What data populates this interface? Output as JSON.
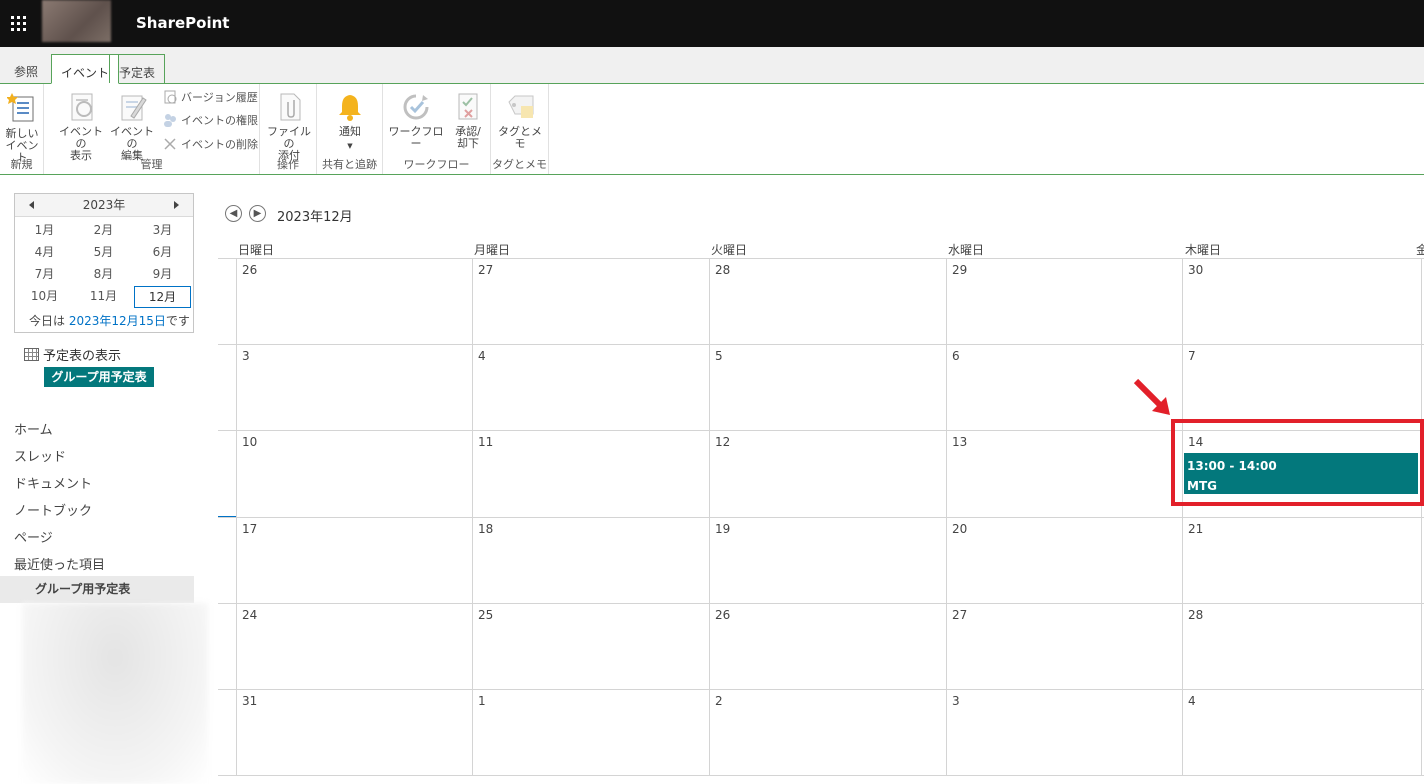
{
  "suitebar": {
    "brand": "SharePoint"
  },
  "tabs": [
    "参照",
    "イベント",
    "予定表"
  ],
  "ribbon": {
    "new_event_l1": "新しい",
    "new_event_l2": "イベント",
    "group_new": "新規",
    "view_event_l1": "イベントの",
    "view_event_l2": "表示",
    "edit_event_l1": "イベントの",
    "edit_event_l2": "編集",
    "version_history": "バージョン履歴",
    "event_permissions": "イベントの権限",
    "delete_event": "イベントの削除",
    "group_manage": "管理",
    "attach_l1": "ファイルの",
    "attach_l2": "添付",
    "group_actions": "操作",
    "notify": "通知",
    "group_share": "共有と追跡",
    "workflow": "ワークフロー",
    "approve_l1": "承認/",
    "approve_l2": "却下",
    "group_workflow": "ワークフロー",
    "tags": "タグとメモ",
    "group_tags": "タグとメモ"
  },
  "minical": {
    "year": "2023年",
    "months": [
      "1月",
      "2月",
      "3月",
      "4月",
      "5月",
      "6月",
      "7月",
      "8月",
      "9月",
      "10月",
      "11月",
      "12月"
    ],
    "selected_index": 11,
    "today_prefix": "今日は ",
    "today_link": "2023年12月15日",
    "today_suffix": "です"
  },
  "left": {
    "calendar_view": "予定表の表示",
    "group_calendar": "グループ用予定表",
    "nav": [
      "ホーム",
      "スレッド",
      "ドキュメント",
      "ノートブック",
      "ページ",
      "最近使った項目"
    ],
    "nav_selected": "グループ用予定表"
  },
  "calendar": {
    "title": "2023年12月",
    "weekdays": [
      "日曜日",
      "月曜日",
      "火曜日",
      "水曜日",
      "木曜日",
      "金"
    ],
    "weeks": [
      [
        "26",
        "27",
        "28",
        "29",
        "30"
      ],
      [
        "3",
        "4",
        "5",
        "6",
        "7"
      ],
      [
        "10",
        "11",
        "12",
        "13",
        "14"
      ],
      [
        "17",
        "18",
        "19",
        "20",
        "21"
      ],
      [
        "24",
        "25",
        "26",
        "27",
        "28"
      ],
      [
        "31",
        "1",
        "2",
        "3",
        "4"
      ]
    ],
    "event": {
      "time": "13:00 - 14:00",
      "title": "MTG"
    }
  },
  "colors": {
    "accent": "#03787c",
    "ribbon_border": "#57a35a",
    "highlight": "#e2202a"
  }
}
